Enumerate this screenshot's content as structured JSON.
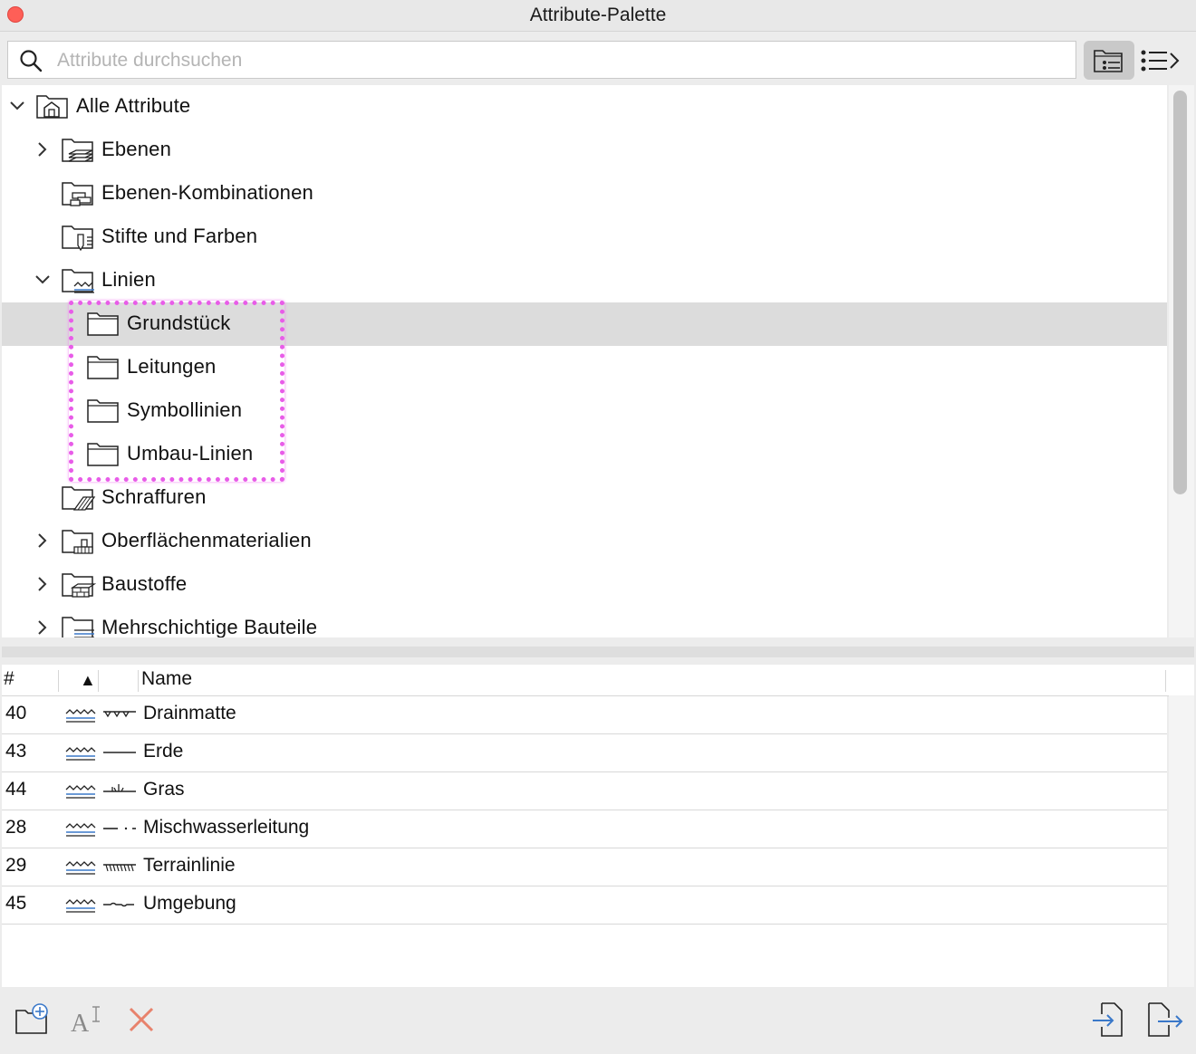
{
  "window": {
    "title": "Attribute-Palette"
  },
  "search": {
    "placeholder": "Attribute durchsuchen",
    "value": ""
  },
  "tree": {
    "root": "Alle Attribute",
    "items": [
      {
        "label": "Ebenen",
        "icon": "folder-layers-icon",
        "expander": "collapsed"
      },
      {
        "label": "Ebenen-Kombinationen",
        "icon": "folder-layer-combinations-icon",
        "expander": "none"
      },
      {
        "label": "Stifte und Farben",
        "icon": "folder-pens-icon",
        "expander": "none"
      },
      {
        "label": "Linien",
        "icon": "folder-lines-icon",
        "expander": "expanded"
      },
      {
        "label": "Grundstück",
        "icon": "folder-icon",
        "selected": true
      },
      {
        "label": "Leitungen",
        "icon": "folder-icon"
      },
      {
        "label": "Symbollinien",
        "icon": "folder-icon"
      },
      {
        "label": "Umbau-Linien",
        "icon": "folder-icon"
      },
      {
        "label": "Schraffuren",
        "icon": "folder-fills-icon",
        "expander": "none"
      },
      {
        "label": "Oberflächenmaterialien",
        "icon": "folder-surfaces-icon",
        "expander": "collapsed"
      },
      {
        "label": "Baustoffe",
        "icon": "folder-building-materials-icon",
        "expander": "collapsed"
      },
      {
        "label": "Mehrschichtige Bauteile",
        "icon": "folder-composites-icon",
        "expander": "collapsed"
      }
    ]
  },
  "table": {
    "headers": {
      "index": "#",
      "sort": "▲",
      "name": "Name"
    },
    "rows": [
      {
        "num": "40",
        "name": "Drainmatte",
        "pattern": "drainmatte"
      },
      {
        "num": "43",
        "name": "Erde",
        "pattern": "erde"
      },
      {
        "num": "44",
        "name": "Gras",
        "pattern": "gras"
      },
      {
        "num": "28",
        "name": "Mischwasserleitung",
        "pattern": "misch"
      },
      {
        "num": "29",
        "name": "Terrainlinie",
        "pattern": "terrain"
      },
      {
        "num": "45",
        "name": "Umgebung",
        "pattern": "umgebung"
      }
    ]
  },
  "colors": {
    "accent": "#3a78c9",
    "highlight": "#e85ce8",
    "delete": "#e8826c",
    "selected_row": "#dcdcdc"
  }
}
